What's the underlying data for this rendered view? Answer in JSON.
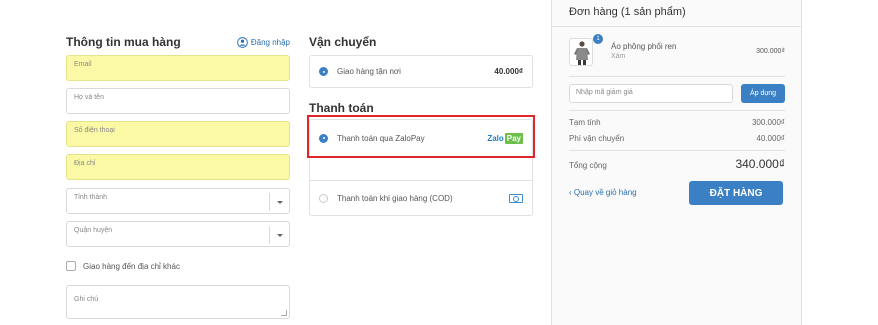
{
  "buyer": {
    "title": "Thông tin mua hàng",
    "login_label": "Đăng nhập",
    "email_placeholder": "Email",
    "name_placeholder": "Họ và tên",
    "phone_placeholder": "Số điện thoại",
    "address_placeholder": "Địa chỉ",
    "province_placeholder": "Tỉnh thành",
    "district_placeholder": "Quận huyện",
    "ship_other_label": "Giao hàng đến địa chỉ khác",
    "note_placeholder": "Ghi chú"
  },
  "shipping": {
    "title": "Vận chuyển",
    "option_label": "Giao hàng tận nơi",
    "option_price": "40.000₫"
  },
  "payment": {
    "title": "Thanh toán",
    "zalopay_label": "Thanh toán qua ZaloPay",
    "zalopay_logo_zalo": "Zalo",
    "zalopay_logo_pay": "Pay",
    "cod_label": "Thanh toán khi giao hàng (COD)"
  },
  "order": {
    "title": "Đơn hàng (1 sản phẩm)",
    "product": {
      "quantity": "1",
      "name": "Áo phông phối ren",
      "variant": "Xám",
      "price": "300.000₫"
    },
    "coupon_placeholder": "Nhập mã giảm giá",
    "apply_label": "Áp dụng",
    "subtotal_label": "Tạm tính",
    "subtotal_value": "300.000₫",
    "shipping_fee_label": "Phí vận chuyển",
    "shipping_fee_value": "40.000₫",
    "total_label": "Tổng cộng",
    "total_value": "340.000₫",
    "back_label": "‹ Quay về giỏ hàng",
    "place_order_label": "ĐẶT HÀNG"
  },
  "colors": {
    "accent": "#3b7fc4",
    "highlight_field": "#fbf9a5",
    "annotation_red": "#e0262a"
  }
}
